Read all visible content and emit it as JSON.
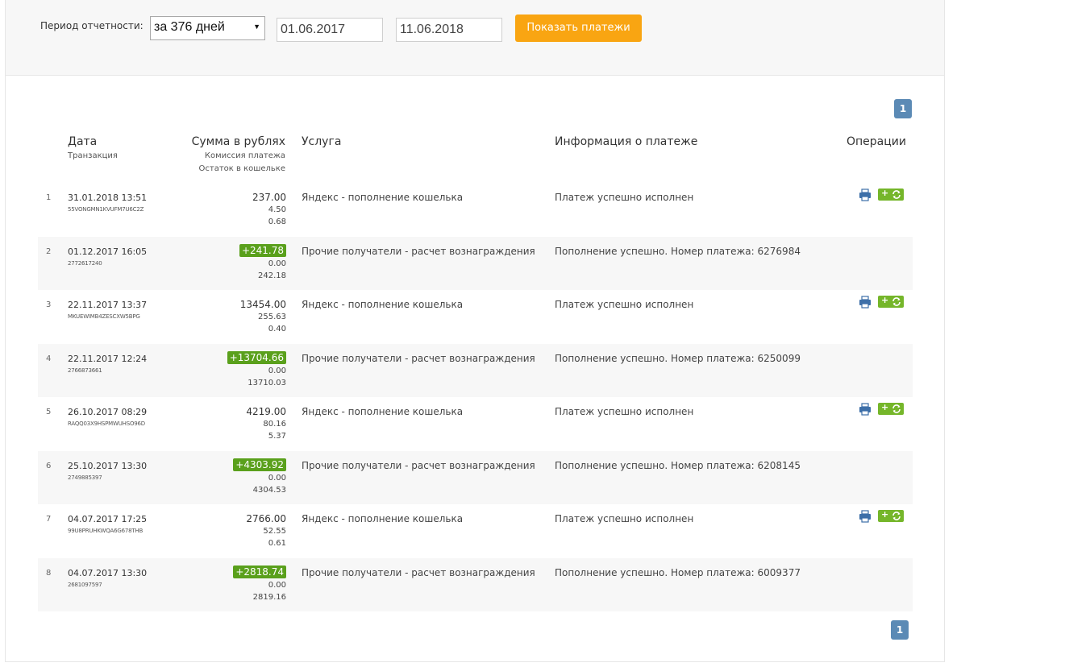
{
  "filter": {
    "label": "Период отчетности:",
    "period_value": "за 376 дней",
    "date_from": "01.06.2017",
    "date_to": "11.06.2018",
    "show_button": "Показать платежи"
  },
  "pagination": {
    "current_page": "1"
  },
  "table": {
    "headers": {
      "date": "Дата",
      "date_sub": "Транзакция",
      "amount": "Сумма в рублях",
      "amount_sub1": "Комиссия платежа",
      "amount_sub2": "Остаток в кошельке",
      "service": "Услуга",
      "info": "Информация о платеже",
      "ops": "Операции"
    },
    "rows": [
      {
        "num": "1",
        "date": "31.01.2018 13:51",
        "trx": "55VONGMN1KVUFM7U6C2Z",
        "amount": "237.00",
        "plus": false,
        "fee": "4.50",
        "balance": "0.68",
        "service": "Яндекс - пополнение кошелька",
        "info": "Платеж успешно исполнен",
        "has_ops": true
      },
      {
        "num": "2",
        "date": "01.12.2017 16:05",
        "trx": "2772617240",
        "amount": "+241.78",
        "plus": true,
        "fee": "0.00",
        "balance": "242.18",
        "service": "Прочие получатели - расчет вознаграждения",
        "info": "Пополнение успешно. Номер платежа: 6276984",
        "has_ops": false
      },
      {
        "num": "3",
        "date": "22.11.2017 13:37",
        "trx": "MKUEWIMB4ZESCXW5BPG",
        "amount": "13454.00",
        "plus": false,
        "fee": "255.63",
        "balance": "0.40",
        "service": "Яндекс - пополнение кошелька",
        "info": "Платеж успешно исполнен",
        "has_ops": true
      },
      {
        "num": "4",
        "date": "22.11.2017 12:24",
        "trx": "2766873661",
        "amount": "+13704.66",
        "plus": true,
        "fee": "0.00",
        "balance": "13710.03",
        "service": "Прочие получатели - расчет вознаграждения",
        "info": "Пополнение успешно. Номер платежа: 6250099",
        "has_ops": false
      },
      {
        "num": "5",
        "date": "26.10.2017 08:29",
        "trx": "RAQQ03X9HSPMWUHSO96D",
        "amount": "4219.00",
        "plus": false,
        "fee": "80.16",
        "balance": "5.37",
        "service": "Яндекс - пополнение кошелька",
        "info": "Платеж успешно исполнен",
        "has_ops": true
      },
      {
        "num": "6",
        "date": "25.10.2017 13:30",
        "trx": "2749885397",
        "amount": "+4303.92",
        "plus": true,
        "fee": "0.00",
        "balance": "4304.53",
        "service": "Прочие получатели - расчет вознаграждения",
        "info": "Пополнение успешно. Номер платежа: 6208145",
        "has_ops": false
      },
      {
        "num": "7",
        "date": "04.07.2017 17:25",
        "trx": "99U8PRUHKWQA6G678THB",
        "amount": "2766.00",
        "plus": false,
        "fee": "52.55",
        "balance": "0.61",
        "service": "Яндекс - пополнение кошелька",
        "info": "Платеж успешно исполнен",
        "has_ops": true
      },
      {
        "num": "8",
        "date": "04.07.2017 13:30",
        "trx": "2681097597",
        "amount": "+2818.74",
        "plus": true,
        "fee": "0.00",
        "balance": "2819.16",
        "service": "Прочие получатели - расчет вознаграждения",
        "info": "Пополнение успешно. Номер платежа: 6009377",
        "has_ops": false
      }
    ]
  },
  "icons": {
    "print": "printer-icon",
    "repeat": "repeat-payment-icon"
  },
  "colors": {
    "accent_button": "#f9a512",
    "plus_badge": "#5aa01c",
    "ops_green": "#75b62a",
    "pager": "#5b8ab5",
    "print_blue": "#3d6fa8"
  }
}
